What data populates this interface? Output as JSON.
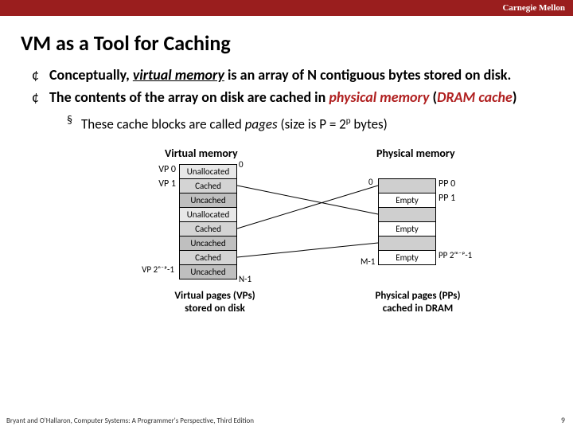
{
  "header": {
    "institution": "Carnegie Mellon"
  },
  "title": "VM as a Tool for Caching",
  "bullets": {
    "b1_pre": "Conceptually, ",
    "b1_ul": "virtual memory",
    "b1_post": " is an array of N contiguous bytes stored on disk.",
    "b2_pre": "The contents of the array on disk are cached in ",
    "b2_phys": "physical memory",
    "b2_mid": " (",
    "b2_dram": "DRAM cache",
    "b2_post": ")",
    "sub_pre": "These cache blocks are called ",
    "sub_ital": "pages",
    "sub_post": " (size is P = 2",
    "sub_sup": "p",
    "sub_end": " bytes)"
  },
  "diagram": {
    "vm_header": "Virtual memory",
    "pm_header": "Physical memory",
    "vm_rows": [
      "Unallocated",
      "Cached",
      "Uncached",
      "Unallocated",
      "Cached",
      "Uncached",
      "Cached",
      "Uncached"
    ],
    "pm_rows": [
      "",
      "Empty",
      "",
      "Empty",
      "",
      "Empty"
    ],
    "vp0": "VP 0",
    "vp1": "VP 1",
    "vplast": "VP 2ⁿ⁻ᵖ-1",
    "zero": "0",
    "n1": "N-1",
    "pp0": "PP 0",
    "pp1": "PP 1",
    "pplast": "PP 2ᵐ⁻ᵖ-1",
    "pm_zero": "0",
    "pm_m1": "M-1",
    "cap_left_l1": "Virtual pages (VPs)",
    "cap_left_l2": "stored on disk",
    "cap_right_l1": "Physical pages (PPs)",
    "cap_right_l2": "cached in DRAM"
  },
  "footer": "Bryant and O'Hallaron, Computer Systems: A Programmer's Perspective, Third Edition",
  "pagenum": "9"
}
